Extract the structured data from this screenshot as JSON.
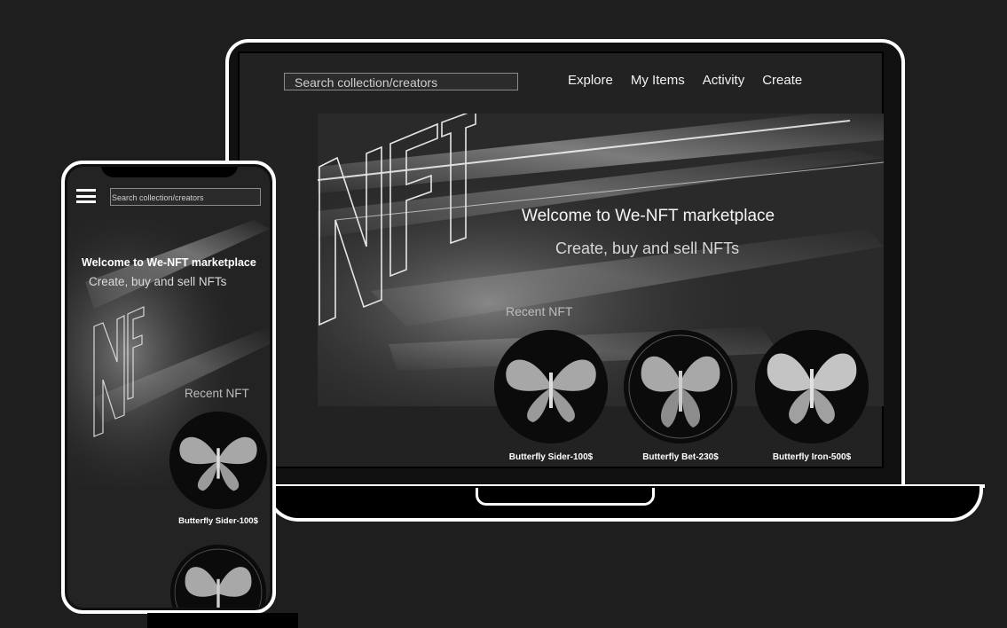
{
  "laptop": {
    "search_placeholder": "Search collection/creators",
    "nav": [
      "Explore",
      "My Items",
      "Activity",
      "Create"
    ],
    "hero": {
      "logo_text": "NFT",
      "welcome": "Welcome to We-NFT marketplace",
      "subtitle": "Create, buy and sell NFTs"
    },
    "recent_title": "Recent NFT",
    "cards": [
      {
        "caption": "Butterfly Sider-100$"
      },
      {
        "caption": "Butterfly Bet-230$"
      },
      {
        "caption": "Butterfly Iron-500$"
      }
    ]
  },
  "phone": {
    "search_placeholder": "Search collection/creators",
    "hero": {
      "logo_text": "NFT",
      "welcome": "Welcome to We-NFT marketplace",
      "subtitle": "Create, buy and sell NFTs"
    },
    "recent_title": "Recent NFT",
    "cards": [
      {
        "caption": "Butterfly Sider-100$"
      }
    ]
  }
}
